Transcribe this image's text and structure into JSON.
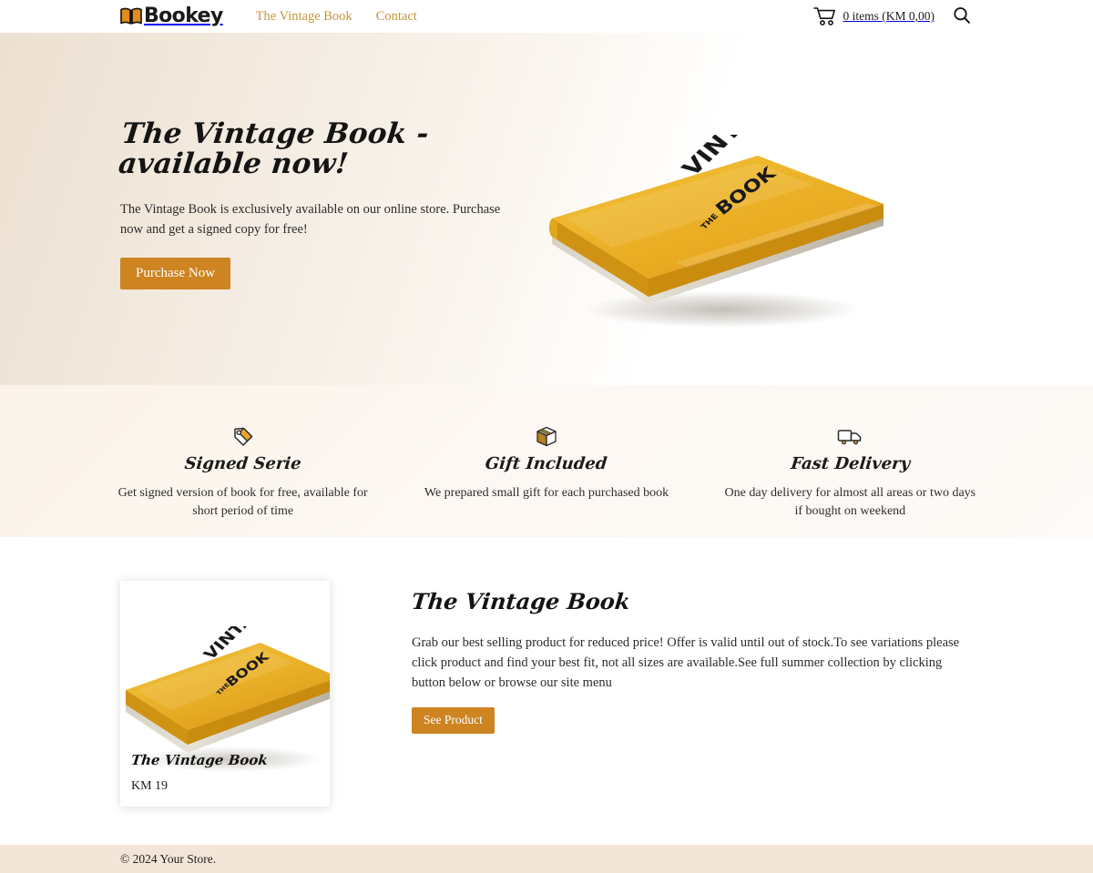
{
  "header": {
    "logo_text": "Bookey",
    "logo_icon": "open-book-icon",
    "nav": [
      {
        "label": "The Vintage Book"
      },
      {
        "label": "Contact"
      }
    ],
    "cart": {
      "icon": "shopping-cart-icon",
      "text": "0 items (KM 0,00)"
    },
    "search_icon": "search-icon"
  },
  "hero": {
    "title": "The Vintage Book - available now!",
    "subtitle": "The Vintage Book is exclusively available on our online store. Purchase now and get a signed copy for free!",
    "cta_label": "Purchase Now",
    "book_cover": {
      "line1": "THE",
      "line2": "VINTAGE",
      "line3": "BOOK"
    }
  },
  "features": [
    {
      "icon": "price-tag-icon",
      "title": "Signed Serie",
      "desc": "Get signed version of book for free, available for short period of time"
    },
    {
      "icon": "gift-box-icon",
      "title": "Gift Included",
      "desc": "We prepared small gift for each purchased book"
    },
    {
      "icon": "delivery-truck-icon",
      "title": "Fast Delivery",
      "desc": "One day delivery for almost all areas or two days if bought on weekend"
    }
  ],
  "product": {
    "card": {
      "title": "The Vintage Book",
      "price": "KM 19"
    },
    "title": "The Vintage Book",
    "description": "Grab our best selling product for reduced price! Offer is valid until out of stock.To see variations please click product and find your best fit, not all sizes are available.See full summer collection by clicking button below or browse our site menu",
    "cta_label": "See Product"
  },
  "footer": {
    "copyright": "© 2024 Your Store."
  },
  "colors": {
    "accent": "#cd8421",
    "nav_link": "#c8943c",
    "book_yellow": "#edb728",
    "footer_bg": "#f3e6d8",
    "hero_bg_start": "#ece0d1"
  }
}
